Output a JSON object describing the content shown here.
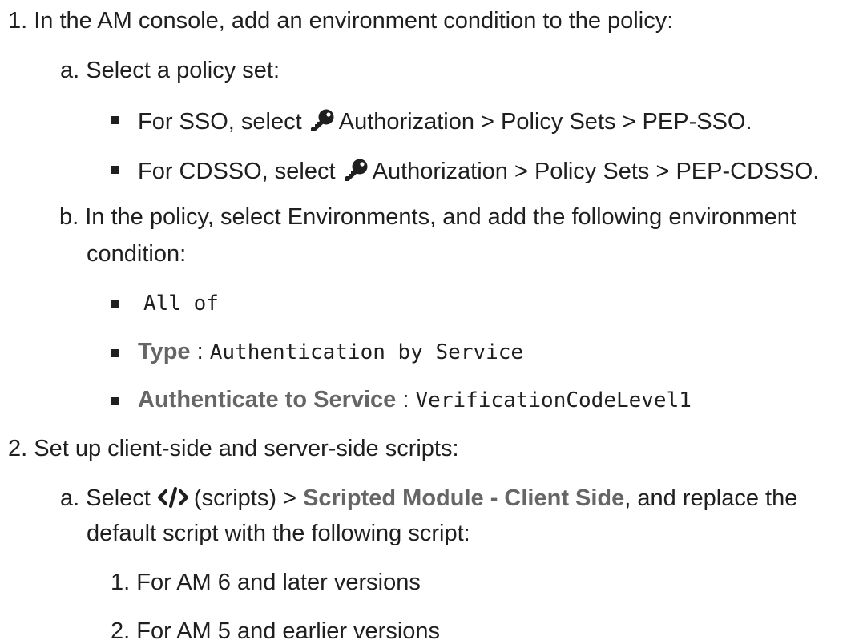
{
  "steps": [
    {
      "number": "1.",
      "text": "In the AM console, add an environment condition to the policy:",
      "substeps": [
        {
          "letter": "a.",
          "text": "Select a policy set:",
          "bullets": [
            {
              "prefix": "For SSO, select",
              "icon": "key-icon",
              "suffix": "Authorization > Policy Sets > PEP-SSO."
            },
            {
              "prefix": "For CDSSO, select",
              "icon": "key-icon",
              "suffix": "Authorization > Policy Sets > PEP-CDSSO."
            }
          ]
        },
        {
          "letter": "b.",
          "text_line1": "In the policy, select Environments, and add the following environment",
          "text_line2": "condition:",
          "bullets": [
            {
              "code": "All of"
            },
            {
              "label": "Type",
              "separator": ":",
              "code": "Authentication by Service"
            },
            {
              "label": "Authenticate to Service",
              "separator": ":",
              "code": "VerificationCodeLevel1"
            }
          ]
        }
      ]
    },
    {
      "number": "2.",
      "text": "Set up client-side and server-side scripts:",
      "substeps": [
        {
          "letter": "a.",
          "prefix": "Select",
          "icon": "code-icon",
          "middle": "(scripts) >",
          "bold": "Scripted Module - Client Side",
          "suffix": ", and replace the",
          "line2": "default script with the following script:",
          "numbered": [
            {
              "number": "1.",
              "text": "For AM 6 and later versions"
            },
            {
              "number": "2.",
              "text": "For AM 5 and earlier versions"
            }
          ]
        }
      ]
    }
  ]
}
